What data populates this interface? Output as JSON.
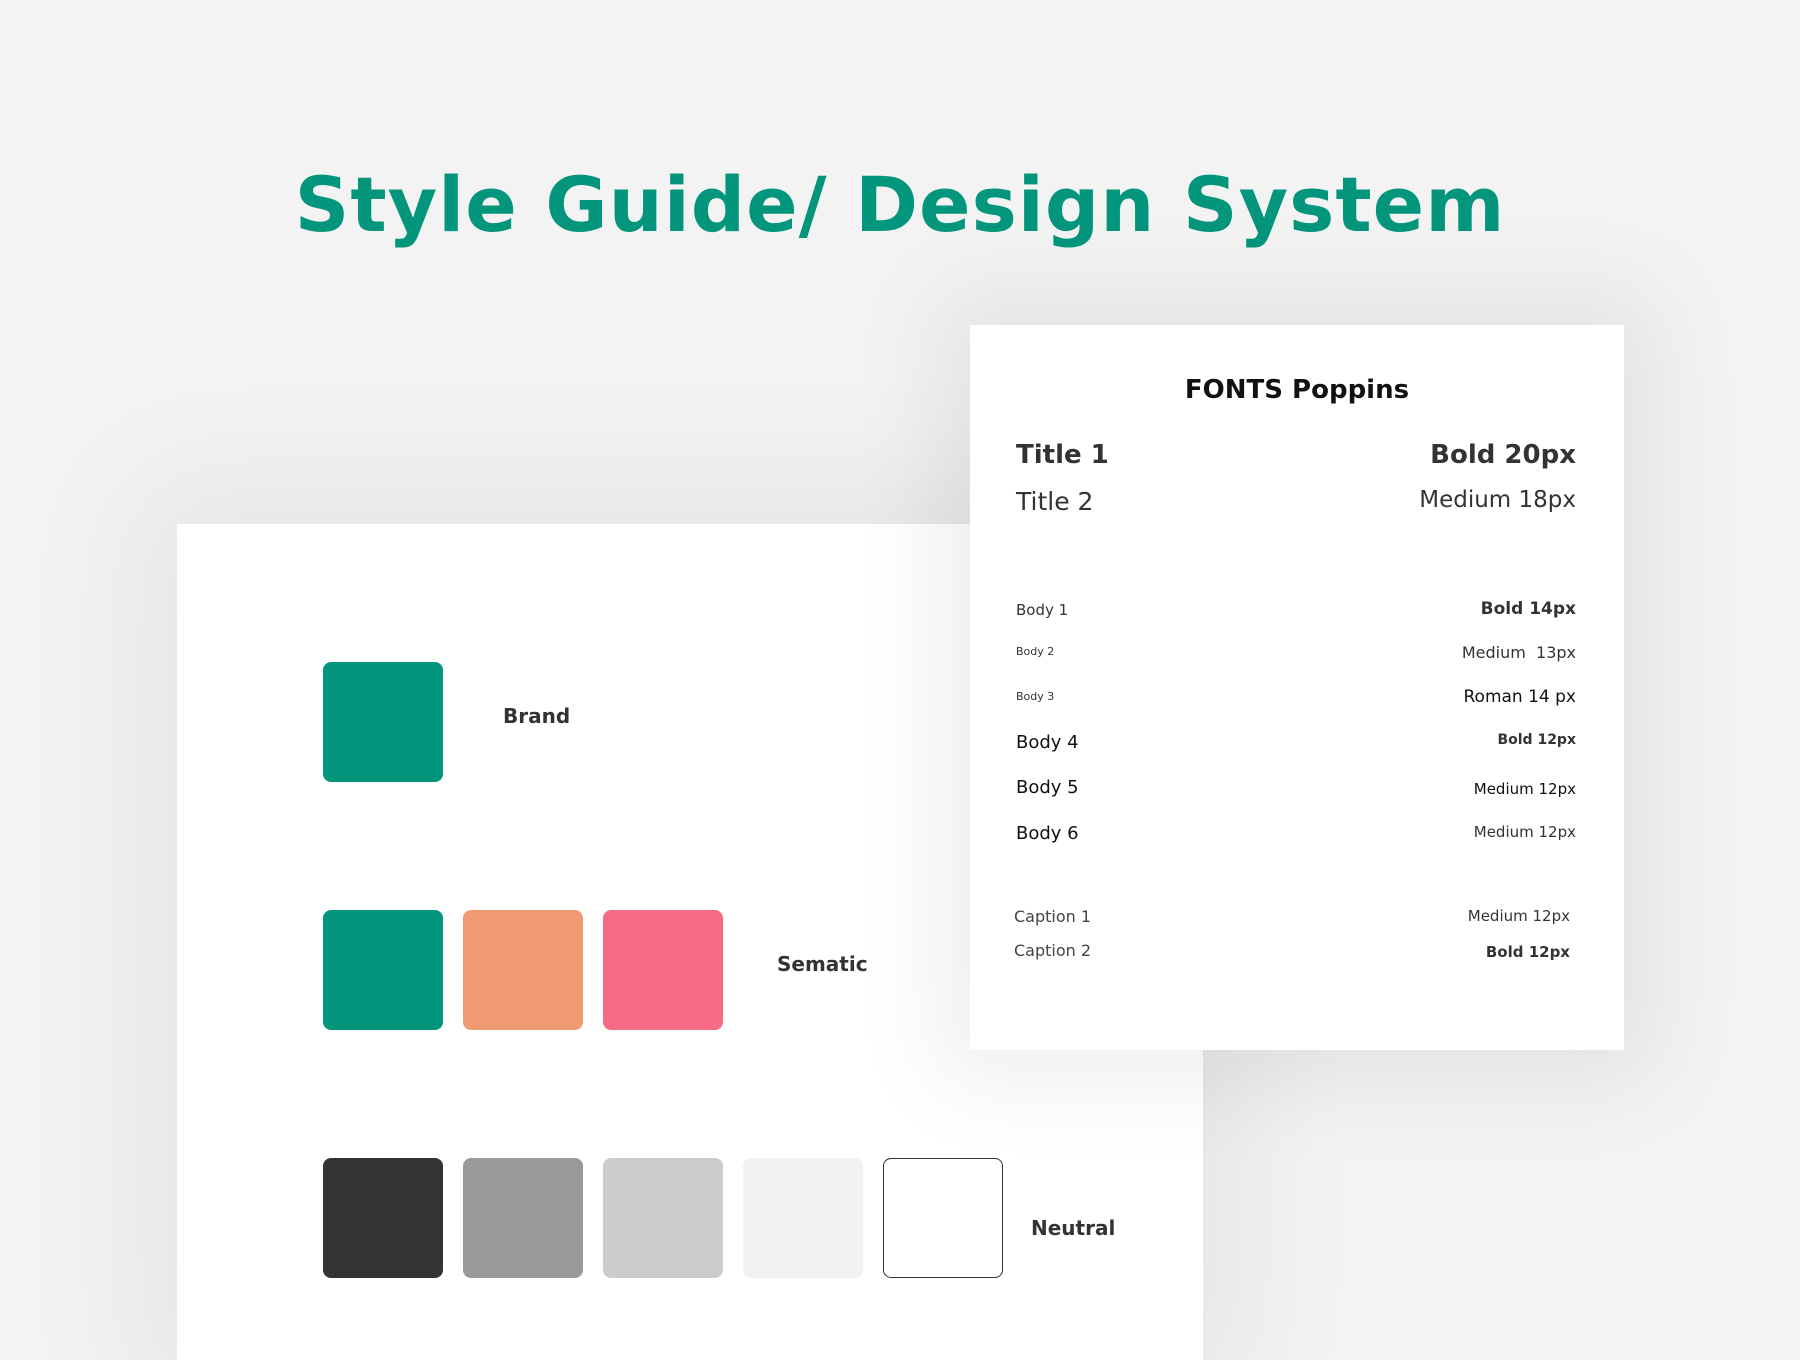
{
  "page": {
    "title": "Style Guide/ Design System"
  },
  "colors": {
    "brand": {
      "label": "Brand",
      "swatches": [
        "#03967c"
      ]
    },
    "semantic": {
      "label": "Sematic",
      "swatches": [
        "#03967c",
        "#f19a72",
        "#f76b85"
      ]
    },
    "neutral": {
      "label": "Neutral",
      "swatches": [
        "#333333",
        "#999999",
        "#cccccc",
        "#f2f2f2",
        "#ffffff"
      ]
    }
  },
  "fonts": {
    "title": "FONTS Poppins",
    "rows": [
      {
        "name": "Title 1",
        "spec": "Bold 20px"
      },
      {
        "name": "Title 2",
        "spec": "Medium 18px"
      },
      {
        "name": "Body 1",
        "spec": "Bold 14px"
      },
      {
        "name": "Body 2",
        "spec": "Medium  13px"
      },
      {
        "name": "Body 3",
        "spec": "Roman 14 px"
      },
      {
        "name": "Body 4",
        "spec": "Bold 12px"
      },
      {
        "name": "Body 5",
        "spec": "Medium 12px"
      },
      {
        "name": "Body 6",
        "spec": "Medium 12px"
      },
      {
        "name": "Caption 1",
        "spec": "Medium 12px"
      },
      {
        "name": "Caption 2",
        "spec": "Bold 12px"
      }
    ]
  }
}
